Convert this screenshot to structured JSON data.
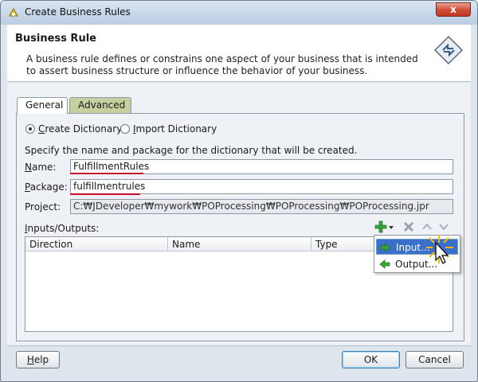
{
  "window": {
    "title": "Create Business Rules",
    "close_label": "x",
    "icon": "jdeveloper-app-icon"
  },
  "header": {
    "title": "Business Rule",
    "description": "A business rule defines or constrains one aspect of your business that is intended to assert business structure or influence the behavior of your business.",
    "icon": "business-rule-diamond-icon"
  },
  "tabs": [
    {
      "label": "General",
      "selected": true
    },
    {
      "label": "Advanced",
      "selected": false
    }
  ],
  "options": {
    "create": {
      "label_u": "C",
      "label_rest": "reate Dictionary",
      "checked": true
    },
    "import": {
      "label_u": "I",
      "label_rest": "mport Dictionary",
      "checked": false
    }
  },
  "form": {
    "instruction": "Specify the name and package for the dictionary that will be created.",
    "name_label_u": "N",
    "name_label_rest": "ame:",
    "name_value": "FulfillmentRules",
    "package_label_u": "P",
    "package_label_rest": "ackage:",
    "package_value": "fulfillmentrules",
    "project_label": "Project:",
    "project_value": "C:₩JDeveloper₩mywork₩POProcessing₩POProcessing₩POProcessing.jpr"
  },
  "io": {
    "label_u": "I",
    "label_rest": "nputs/Outputs:",
    "toolbar": [
      "add-icon",
      "dropdown-arrow-icon",
      "delete-icon",
      "move-up-icon",
      "move-down-icon"
    ],
    "columns": [
      "Direction",
      "Name",
      "Type"
    ]
  },
  "popup_menu": {
    "items": [
      {
        "label": "Input...",
        "icon": "input-arrow-icon",
        "active": true
      },
      {
        "label": "Output...",
        "icon": "output-arrow-icon",
        "active": false
      }
    ]
  },
  "footer": {
    "help_u": "H",
    "help_rest": "elp",
    "ok": "OK",
    "cancel": "Cancel"
  },
  "colors": {
    "accent_red_underline": "#c8102e",
    "menu_highlight": "#3b70c8",
    "advanced_tab": "#c5d0a0"
  }
}
